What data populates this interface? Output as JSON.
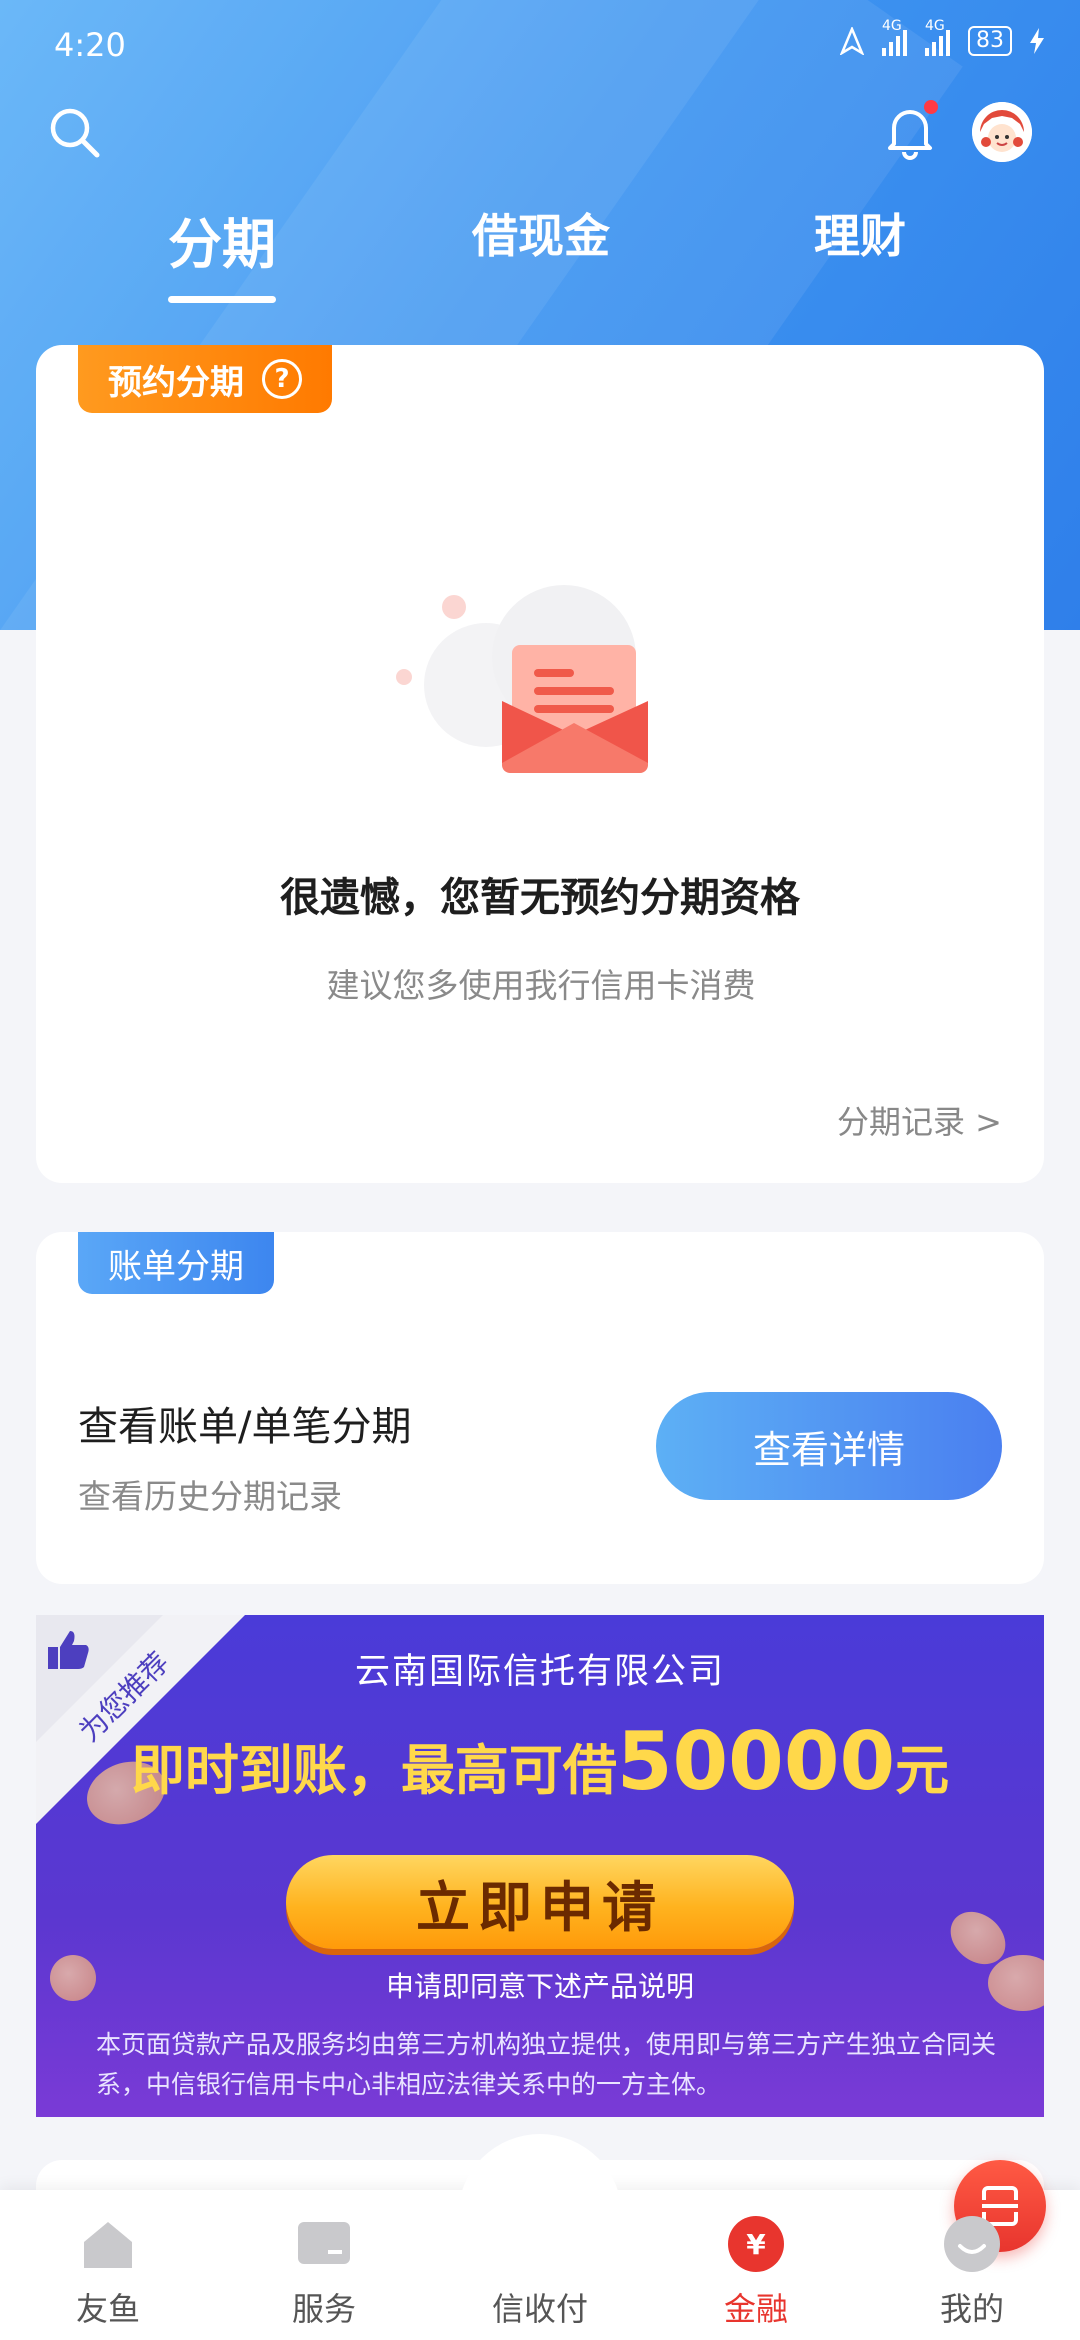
{
  "status_bar": {
    "time": "4:20",
    "network1": "4G",
    "network2": "4G",
    "battery": "83"
  },
  "header": {
    "search_icon": "search-icon",
    "bell_icon": "bell-icon",
    "avatar": "avatar"
  },
  "tabs": [
    {
      "label": "分期",
      "active": true
    },
    {
      "label": "借现金",
      "active": false
    },
    {
      "label": "理财",
      "active": false
    }
  ],
  "reserve_card": {
    "badge": "预约分期",
    "badge_icon": "question-icon",
    "empty_title": "很遗憾，您暂无预约分期资格",
    "empty_sub": "建议您多使用我行信用卡消费",
    "record_link": "分期记录 >"
  },
  "bill_card": {
    "badge": "账单分期",
    "title": "查看账单/单笔分期",
    "subtitle": "查看历史分期记录",
    "button": "查看详情"
  },
  "banner": {
    "ribbon": "为您推荐",
    "company": "云南国际信托有限公司",
    "headline_prefix": "即时到账，最高可借",
    "headline_amount": "50000",
    "headline_unit": "元",
    "apply_button": "立即申请",
    "note": "申请即同意下述产品说明",
    "disclaimer": "本页面贷款产品及服务均由第三方机构独立提供，使用即与第三方产生独立合同关系，中信银行信用卡中心非相应法律关系中的一方主体。"
  },
  "bottom_nav": [
    {
      "label": "友鱼",
      "icon": "home-icon",
      "active": false
    },
    {
      "label": "服务",
      "icon": "service-icon",
      "active": false
    },
    {
      "label": "信收付",
      "icon": "scan-icon",
      "active": false
    },
    {
      "label": "金融",
      "icon": "yen-icon",
      "active": true
    },
    {
      "label": "我的",
      "icon": "profile-icon",
      "active": false
    }
  ],
  "colors": {
    "brand_blue": "#3f96f1",
    "accent_red": "#e8352e",
    "badge_orange": "#ff8a10",
    "banner_purple": "#5b37d0"
  }
}
